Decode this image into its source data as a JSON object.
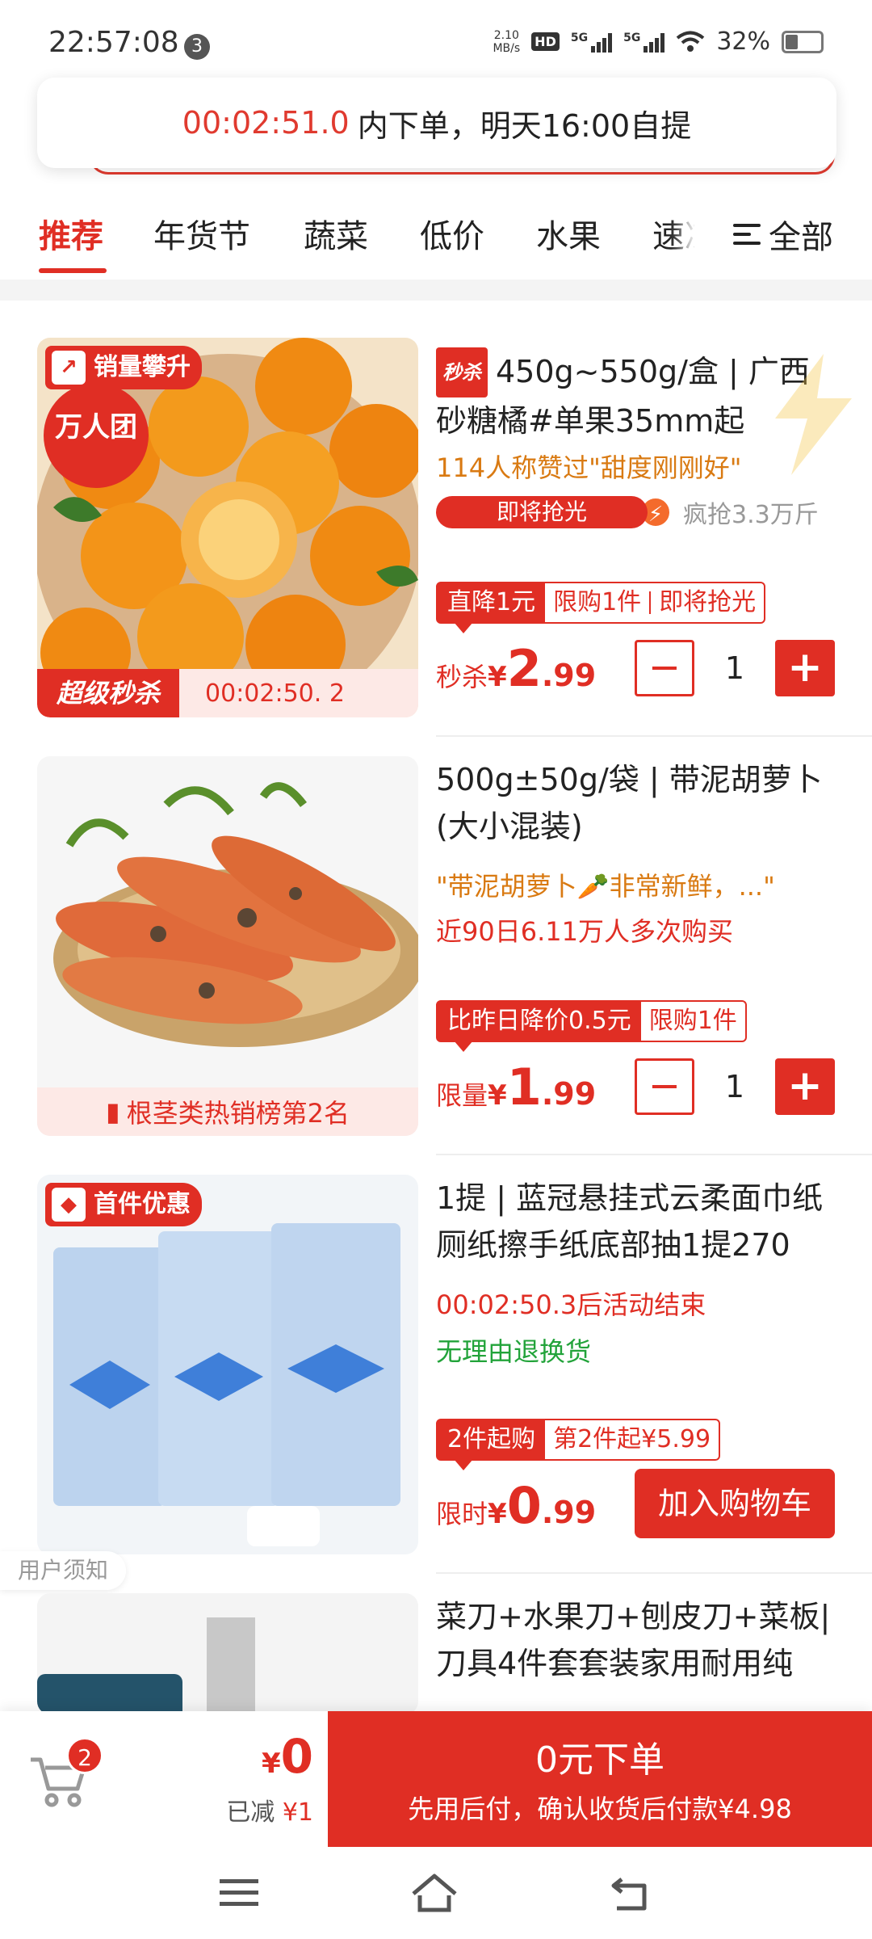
{
  "status": {
    "time": "22:57:08",
    "notif_count": "3",
    "net_speed_top": "2.10",
    "net_speed_bottom": "MB/s",
    "hd": "HD",
    "net1": "5G",
    "net2": "5G",
    "battery": "32%"
  },
  "banner": {
    "countdown": "00:02:51.0",
    "text": "内下单，明天16:00自提"
  },
  "tabs": {
    "items": [
      "推荐",
      "年货节",
      "蔬菜",
      "低价",
      "水果",
      "速冻"
    ],
    "all_label": "全部"
  },
  "products": [
    {
      "seckill_tag": "秒杀",
      "title": "450g~550g/盒 | 广西砂糖橘#单果35mm起",
      "praise": "114人称赞过\"甜度刚刚好\"",
      "progress_label": "即将抢光",
      "progress_text": "疯抢3.3万斤",
      "tag_fill": "直降1元",
      "tag_a": "限购1件",
      "tag_b": "即将抢光",
      "price_label": "秒杀",
      "price_yen": "¥",
      "price_int": "2",
      "price_dec": ".99",
      "qty": "1",
      "img_badge": "销量攀升",
      "img_round": "万人团",
      "img_bottom_label": "超级秒杀",
      "img_countdown": "00:02:50. 2"
    },
    {
      "title": "500g±50g/袋 | 带泥胡萝卜(大小混装)",
      "praise": "\"带泥胡萝卜🥕非常新鲜，...\"",
      "sales": "近90日6.11万人多次购买",
      "tag_fill": "比昨日降价0.5元",
      "tag_a": "限购1件",
      "price_label": "限量",
      "price_yen": "¥",
      "price_int": "1",
      "price_dec": ".99",
      "qty": "1",
      "rank": "根茎类热销榜第2名"
    },
    {
      "title": "1提 | 蓝冠悬挂式云柔面巾纸厕纸擦手纸底部抽1提270",
      "countdown": "00:02:50.3后活动结束",
      "service": "无理由退换货",
      "tag_fill": "2件起购",
      "tag_a": "第2件起¥5.99",
      "price_label": "限时",
      "price_yen": "¥",
      "price_int": "0",
      "price_dec": ".99",
      "cart_button": "加入购物车",
      "img_badge": "首件优惠"
    },
    {
      "title": "菜刀+水果刀+刨皮刀+菜板| 刀具4件套套装家用耐用纯"
    }
  ],
  "user_notice": "用户须知",
  "bottom": {
    "cart_count": "2",
    "total_yen": "¥",
    "total_value": "0",
    "reduced_label": "已减",
    "reduced_value": "¥1",
    "checkout_main": "0元下单",
    "checkout_sub": "先用后付，确认收货后付款¥4.98"
  },
  "colors": {
    "accent": "#e02e24",
    "praise": "#d97a12",
    "service": "#22a33a"
  }
}
